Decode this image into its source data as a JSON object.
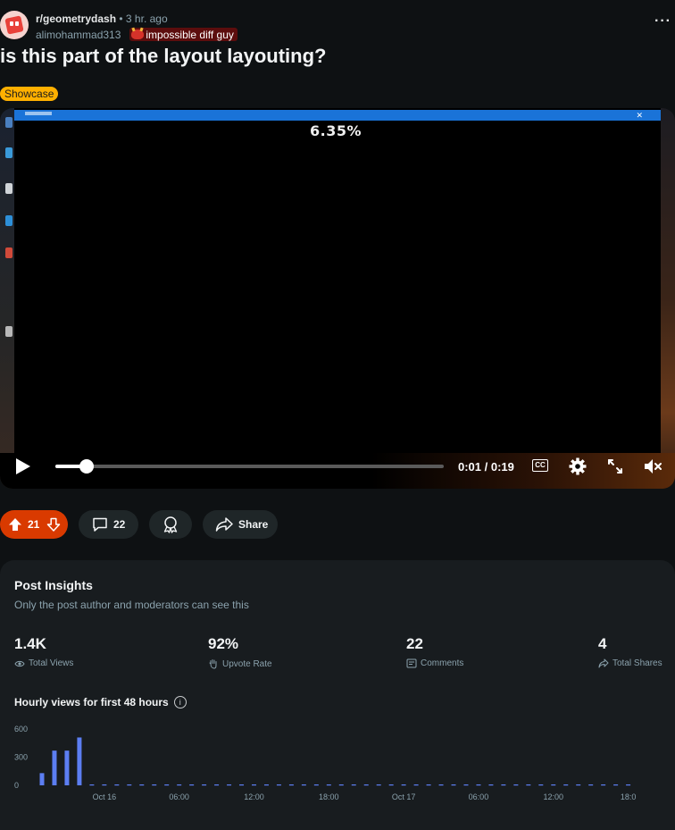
{
  "post": {
    "subreddit": "r/geometrydash",
    "time": "3 hr. ago",
    "author": "alimohammad313",
    "flair": "impossible diff guy",
    "title": "is this part of the layout layouting?",
    "tag": "Showcase",
    "more": "···"
  },
  "video": {
    "overlay_percent": "6.35%",
    "time_display": "0:01 / 0:19",
    "cc_label": "CC",
    "progress": 0.08
  },
  "actions": {
    "vote_count": "21",
    "comment_count": "22",
    "share_label": "Share"
  },
  "insights": {
    "title": "Post Insights",
    "subtitle": "Only the post author and moderators can see this",
    "stats": [
      {
        "value": "1.4K",
        "label": "Total Views",
        "icon": "eye-icon"
      },
      {
        "value": "92%",
        "label": "Upvote Rate",
        "icon": "hand-icon"
      },
      {
        "value": "22",
        "label": "Comments",
        "icon": "comment-icon"
      },
      {
        "value": "4",
        "label": "Total Shares",
        "icon": "share-icon"
      }
    ],
    "chart_title": "Hourly views for first 48 hours",
    "info": "i"
  },
  "chart_data": {
    "type": "bar",
    "title": "Hourly views for first 48 hours",
    "xlabel": "",
    "ylabel": "",
    "ylim": [
      0,
      600
    ],
    "y_ticks": [
      "600",
      "300",
      "0"
    ],
    "x_tick_labels": [
      "Oct 16",
      "06:00",
      "12:00",
      "18:00",
      "Oct 17",
      "06:00",
      "12:00",
      "18:0"
    ],
    "values": [
      130,
      370,
      370,
      510,
      0,
      0,
      0,
      0,
      0,
      0,
      0,
      0,
      0,
      0,
      0,
      0,
      0,
      0,
      0,
      0,
      0,
      0,
      0,
      0,
      0,
      0,
      0,
      0,
      0,
      0,
      0,
      0,
      0,
      0,
      0,
      0,
      0,
      0,
      0,
      0,
      0,
      0,
      0,
      0,
      0,
      0,
      0,
      0
    ],
    "bar_color": "#5c7ef2",
    "grid": false
  }
}
